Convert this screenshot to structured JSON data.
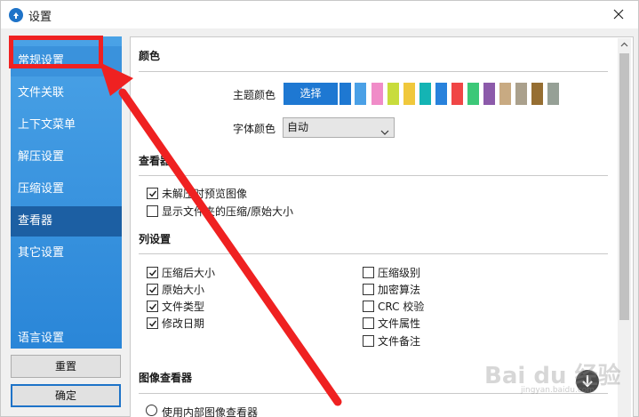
{
  "window": {
    "title": "设置",
    "app_icon": "app-logo-icon",
    "close_icon": "close-icon"
  },
  "sidebar": {
    "items": [
      {
        "label": "常规设置",
        "state": "highlighted"
      },
      {
        "label": "文件关联"
      },
      {
        "label": "上下文菜单"
      },
      {
        "label": "解压设置"
      },
      {
        "label": "压缩设置"
      },
      {
        "label": "查看器",
        "state": "selected"
      },
      {
        "label": "其它设置"
      },
      {
        "label": "语言设置"
      }
    ],
    "reset_label": "重置",
    "ok_label": "确定"
  },
  "color_section": {
    "title": "颜色",
    "theme_color_label": "主题颜色",
    "pick_button": "选择",
    "swatches": [
      "#1e78d2",
      "#4aa0e6",
      "#f08cc8",
      "#c8dc3c",
      "#f0c83c",
      "#14b4b4",
      "#2882dc",
      "#f04646",
      "#3cc878",
      "#8c5aaa",
      "#c8aa82",
      "#aaa08c",
      "#966e32",
      "#96a096"
    ],
    "font_color_label": "字体颜色",
    "font_color_value": "自动"
  },
  "viewer_section": {
    "title": "查看器",
    "options": [
      {
        "label": "未解压时预览图像",
        "checked": true
      },
      {
        "label": "显示文件夹的压缩/原始大小",
        "checked": false
      }
    ]
  },
  "columns_section": {
    "title": "列设置",
    "left": [
      {
        "label": "压缩后大小",
        "checked": true
      },
      {
        "label": "原始大小",
        "checked": true
      },
      {
        "label": "文件类型",
        "checked": true
      },
      {
        "label": "修改日期",
        "checked": true
      }
    ],
    "right": [
      {
        "label": "压缩级别",
        "checked": false
      },
      {
        "label": "加密算法",
        "checked": false
      },
      {
        "label": "CRC 校验",
        "checked": false
      },
      {
        "label": "文件属性",
        "checked": false
      },
      {
        "label": "文件备注",
        "checked": false
      }
    ]
  },
  "image_viewer_section": {
    "title": "图像查看器",
    "option": "使用内部图像查看器"
  },
  "watermark": {
    "text": "Bai du 经验",
    "sub": "jingyan.baidu.com"
  },
  "colors": {
    "accent": "#1e78d2",
    "annotation": "#ef2121",
    "sidebar": "#2a86d8"
  }
}
